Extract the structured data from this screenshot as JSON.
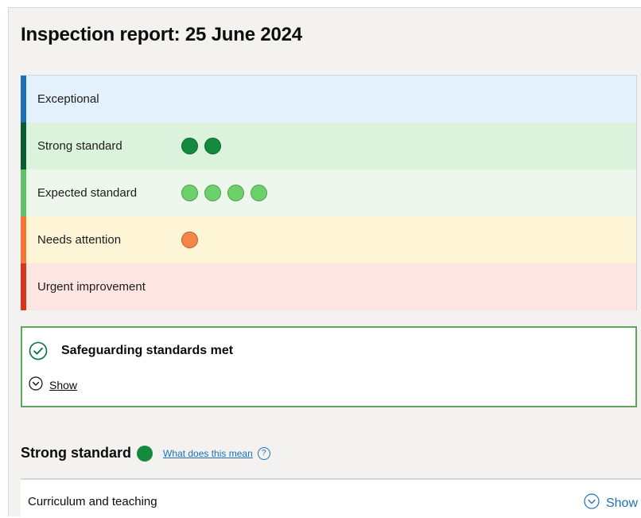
{
  "report": {
    "title": "Inspection report: 25 June 2024"
  },
  "scale": {
    "rows": [
      {
        "label": "Exceptional",
        "bar_color": "#1d70b8",
        "bg_color": "#e3f1fc",
        "dot_color": "#1d70b8",
        "count": 0
      },
      {
        "label": "Strong standard",
        "bar_color": "#0b5c30",
        "bg_color": "#dbf3dc",
        "dot_color": "#138a3e",
        "count": 2
      },
      {
        "label": "Expected standard",
        "bar_color": "#60c36a",
        "bg_color": "#eef7ec",
        "dot_color": "#6cd16b",
        "count": 4
      },
      {
        "label": "Needs attention",
        "bar_color": "#f47738",
        "bg_color": "#fef5d6",
        "dot_color": "#f58549",
        "count": 1
      },
      {
        "label": "Urgent improvement",
        "bar_color": "#d4351c",
        "bg_color": "#fde5e2",
        "dot_color": "#d4351c",
        "count": 0
      }
    ]
  },
  "safeguarding": {
    "title": "Safeguarding standards met",
    "show_label": "Show",
    "accent_color": "#00703c"
  },
  "summary": {
    "title": "Strong standard",
    "dot_color": "#138a3e",
    "link_text": "What does this mean",
    "help_glyph": "?"
  },
  "accordion": {
    "first_item_label": "Curriculum and teaching",
    "show_label": "Show"
  }
}
